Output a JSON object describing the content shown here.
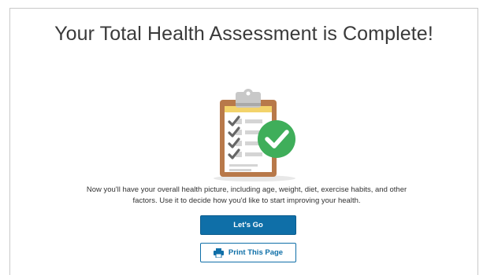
{
  "page": {
    "title": "Your Total Health Assessment is Complete!",
    "description": "Now you'll have your overall health picture, including age, weight, diet, exercise habits, and other factors. Use it to decide how you'd like to start improving your health."
  },
  "actions": {
    "primary_label": "Let's Go",
    "print_label": "Print This Page"
  },
  "illustration": {
    "icon": "clipboard-checklist-icon",
    "badge_icon": "check-circle-icon"
  },
  "colors": {
    "primary": "#0f6fa8",
    "check_green": "#3fae5a",
    "clipboard_brown": "#b8794a",
    "clipboard_top": "#f3d36b"
  }
}
